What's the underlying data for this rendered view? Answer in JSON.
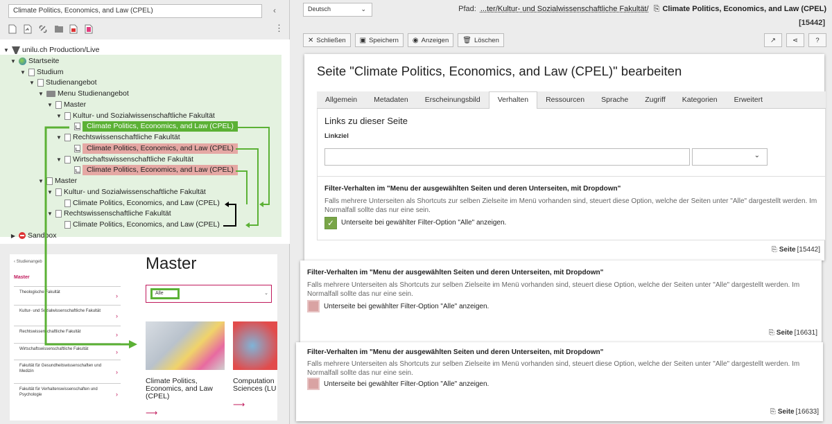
{
  "colors": {
    "accent_green": "#5bb135",
    "accent_red": "#e5a8a4",
    "brand_magenta": "#c0185b",
    "black": "#000000"
  },
  "tree_panel": {
    "search_value": "Climate Politics, Economics, and Law (CPEL)",
    "toolbar_icons": [
      "new-page-icon",
      "new-shortcut-icon",
      "link-icon",
      "folder-icon",
      "red-page-icon",
      "red-doc-icon"
    ],
    "nodes": [
      {
        "label": "unilu.ch Production/Live",
        "icon": "typo3-logo-icon"
      },
      {
        "label": "Startseite",
        "icon": "globe-icon"
      },
      {
        "label": "Studium",
        "icon": "page-icon"
      },
      {
        "label": "Studienangebot",
        "icon": "page-icon"
      },
      {
        "label": "Menu Studienangebot",
        "icon": "folder-icon"
      },
      {
        "label": "Master",
        "icon": "page-icon"
      },
      {
        "label": "Kultur- und Sozialwissenschaftliche Fakultät",
        "icon": "page-icon"
      },
      {
        "label": "Climate Politics, Economics, and Law (CPEL)",
        "icon": "shortcut-icon"
      },
      {
        "label": "Rechtswissenschaftliche Fakultät",
        "icon": "page-icon"
      },
      {
        "label": "Climate Politics, Economics, and Law (CPEL)",
        "icon": "shortcut-icon"
      },
      {
        "label": "Wirtschaftswissenschaftliche Fakultät",
        "icon": "page-icon"
      },
      {
        "label": "Climate Politics, Economics, and Law (CPEL)",
        "icon": "shortcut-icon"
      },
      {
        "label": "Master",
        "icon": "page-icon"
      },
      {
        "label": "Kultur- und Sozialwissenschaftliche Fakultät",
        "icon": "page-icon"
      },
      {
        "label": "Climate Politics, Economics, and Law (CPEL)",
        "icon": "page-icon"
      },
      {
        "label": "Rechtswissenschaftliche Fakultät",
        "icon": "page-icon"
      },
      {
        "label": "Climate Politics, Economics, and Law (CPEL)",
        "icon": "page-icon"
      },
      {
        "label": "Sandbox",
        "icon": "sandbox-icon"
      }
    ]
  },
  "preview": {
    "breadcrumb": "Studienangeb",
    "menu_title": "Master",
    "menu_items": [
      "Theologische Fakultät",
      "Kultur- und Sozialwissenschaftliche Fakultät",
      "Rechtswissenschaftliche Fakultät",
      "Wirtschaftswissenschaftliche Fakultät",
      "Fakultät für Gesundheitswissenschaften und Medizin",
      "Fakultät für Verhaltenswissenschaften und Psychologie"
    ],
    "heading": "Master",
    "select_value": "Alle",
    "card1_title": "Climate Politics, Economics, and Law (CPEL)",
    "card2_title": "Computation Sciences (LU"
  },
  "editor": {
    "language": "Deutsch",
    "path_label": "Pfad:",
    "path_value": "...ter/Kultur- und Sozialwissenschaftliche Fakultät/",
    "path_page": "Climate Politics, Economics, and Law (CPEL)",
    "page_id": "[15442]",
    "buttons": {
      "close": "Schließen",
      "save": "Speichern",
      "view": "Anzeigen",
      "delete": "Löschen"
    },
    "title": "Seite \"Climate Politics, Economics, and Law (CPEL)\" bearbeiten",
    "tabs": [
      "Allgemein",
      "Metadaten",
      "Erscheinungsbild",
      "Verhalten",
      "Ressourcen",
      "Sprache",
      "Zugriff",
      "Kategorien",
      "Erweitert"
    ],
    "active_tab": "Verhalten",
    "links_heading": "Links zu dieser Seite",
    "linkziel_label": "Linkziel",
    "filter_title": "Filter-Verhalten im \"Menu der ausgewählten Seiten und deren Unterseiten, mit Dropdown\"",
    "filter_desc": "Falls mehrere Unterseiten als Shortcuts zur selben Zielseite im Menü vorhanden sind, steuert diese Option, welche der Seiten unter \"Alle\" dargestellt werden. Im Normalfall sollte das nur eine sein.",
    "checkbox_label": "Unterseite bei gewählter Filter-Option \"Alle\" anzeigen.",
    "footer_page_word": "Seite",
    "panels": [
      {
        "id": "[15442]",
        "checked": true
      },
      {
        "id": "[16631]",
        "checked": false
      },
      {
        "id": "[16633]",
        "checked": false
      }
    ]
  }
}
